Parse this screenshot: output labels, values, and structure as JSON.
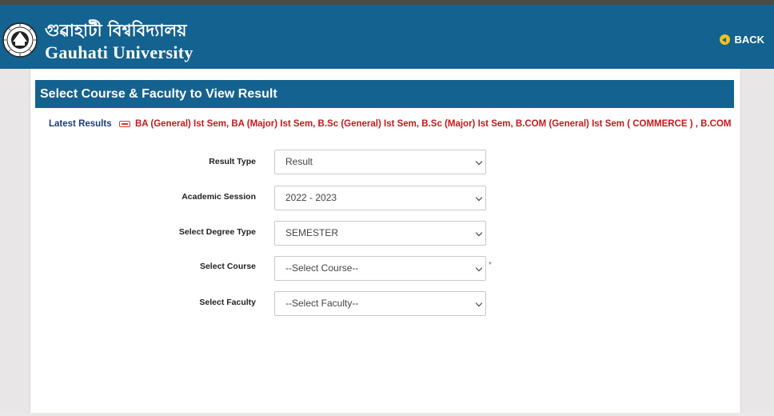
{
  "header": {
    "title_bn": "গুৱাহাটী বিশ্ববিদ্যালয়",
    "title_en": "Gauhati University",
    "back_label": "BACK"
  },
  "panel": {
    "heading": "Select Course & Faculty to View Result"
  },
  "latest": {
    "label": "Latest Results",
    "ticker": "BA (General) Ist Sem, BA (Major) Ist Sem, B.Sc (General) Ist Sem, B.Sc (Major) Ist Sem, B.COM (General) Ist Sem ( COMMERCE ) , B.COM (Major) Ist Sem ( C"
  },
  "form": {
    "fields": [
      {
        "label": "Result Type",
        "value": "Result"
      },
      {
        "label": "Academic Session",
        "value": "2022 - 2023"
      },
      {
        "label": "Select Degree Type",
        "value": "SEMESTER"
      },
      {
        "label": "Select Course",
        "value": "--Select Course--",
        "required_mark": "*"
      },
      {
        "label": "Select Faculty",
        "value": "--Select Faculty--"
      }
    ]
  },
  "colors": {
    "header_bg": "#14628f",
    "ticker_text": "#c41a1a",
    "latest_label": "#1a3b80",
    "back_icon": "#f3c21b"
  },
  "icons": {
    "logo": "university-seal-icon",
    "back": "back-arrow-circle-icon",
    "new": "new-badge-icon",
    "dropdown": "chevron-down-icon"
  }
}
